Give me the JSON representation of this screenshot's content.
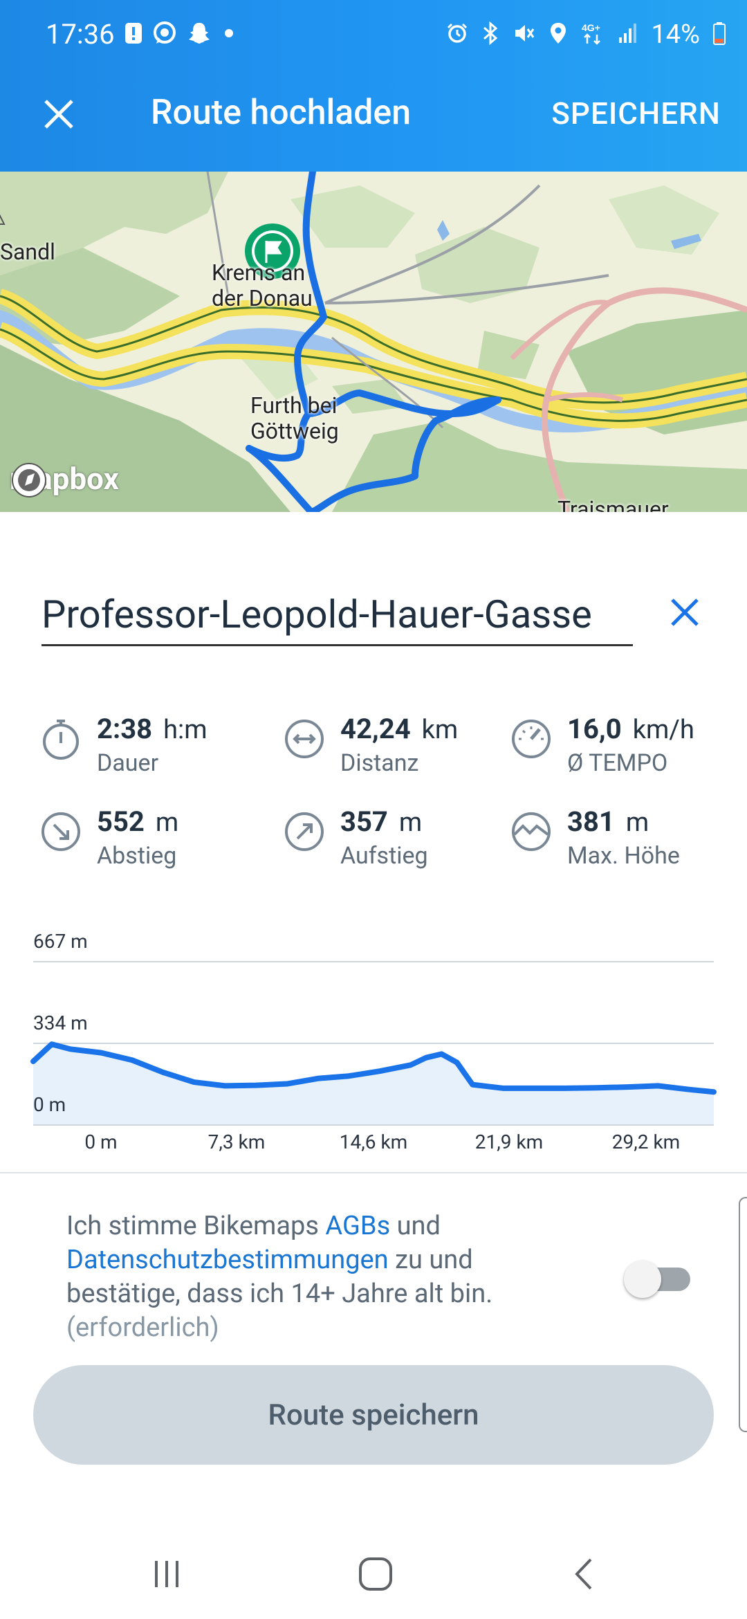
{
  "status_bar": {
    "time": "17:36",
    "battery": "14%",
    "network": "4G+",
    "left_icons": [
      "alert-icon",
      "whatsapp-icon",
      "snapchat-icon",
      "dot-icon"
    ],
    "right_icons": [
      "alarm-icon",
      "bluetooth-icon",
      "mute-icon",
      "location-icon",
      "network-icon",
      "signal-icon",
      "battery-icon"
    ]
  },
  "app_bar": {
    "title": "Route hochladen",
    "save_label": "SPEICHERN"
  },
  "map": {
    "places": {
      "sandl": "Sandl",
      "krems": "Krems an\nder Donau",
      "furth": "Furth bei\nGöttweig",
      "traismauer": "Traismauer"
    },
    "attribution": "mapbox"
  },
  "route_name": {
    "value": "Professor-Leopold-Hauer-Gasse"
  },
  "stats": {
    "duration": {
      "value": "2:38",
      "unit": "h:m",
      "label": "Dauer"
    },
    "distance": {
      "value": "42,24",
      "unit": "km",
      "label": "Distanz"
    },
    "speed": {
      "value": "16,0",
      "unit": "km/h",
      "label": "Ø TEMPO"
    },
    "descent": {
      "value": "552",
      "unit": "m",
      "label": "Abstieg"
    },
    "ascent": {
      "value": "357",
      "unit": "m",
      "label": "Aufstieg"
    },
    "max_height": {
      "value": "381",
      "unit": "m",
      "label": "Max. Höhe"
    }
  },
  "chart_data": {
    "type": "area",
    "y_ticks": [
      "667 m",
      "334 m",
      "0 m"
    ],
    "ylim": [
      0,
      667
    ],
    "x_ticks": [
      "0 m",
      "7,3 km",
      "14,6 km",
      "21,9 km",
      "29,2 km"
    ],
    "xlim": [
      -4.4,
      39.6
    ],
    "series": [
      {
        "x": [
          -4.4,
          -3.2,
          -2.0,
          0,
          2,
          4,
          6,
          8,
          10,
          12,
          14,
          16,
          18,
          20,
          21,
          22,
          23,
          24,
          26,
          28,
          30,
          32,
          34,
          36,
          38,
          39.6
        ],
        "values": [
          260,
          330,
          310,
          295,
          265,
          215,
          175,
          160,
          162,
          168,
          190,
          200,
          220,
          245,
          275,
          290,
          255,
          165,
          150,
          150,
          150,
          152,
          155,
          160,
          145,
          135
        ]
      }
    ],
    "colors": {
      "line": "#1a73e8",
      "fill": "#e6f1fb"
    }
  },
  "consent": {
    "prefix": "Ich stimme Bikemaps ",
    "agb_link": "AGBs",
    "mid": " und ",
    "privacy_link": "Datenschutzbestimmungen",
    "suffix": " zu und bestätige, dass ich 14+ Jahre alt bin.",
    "required": "(erforderlich)",
    "toggle_on": false
  },
  "save_button": "Route speichern",
  "colors": {
    "appbar": "#2196f3",
    "primary": "#1a73e8",
    "button_disabled": "#cfd8de"
  }
}
